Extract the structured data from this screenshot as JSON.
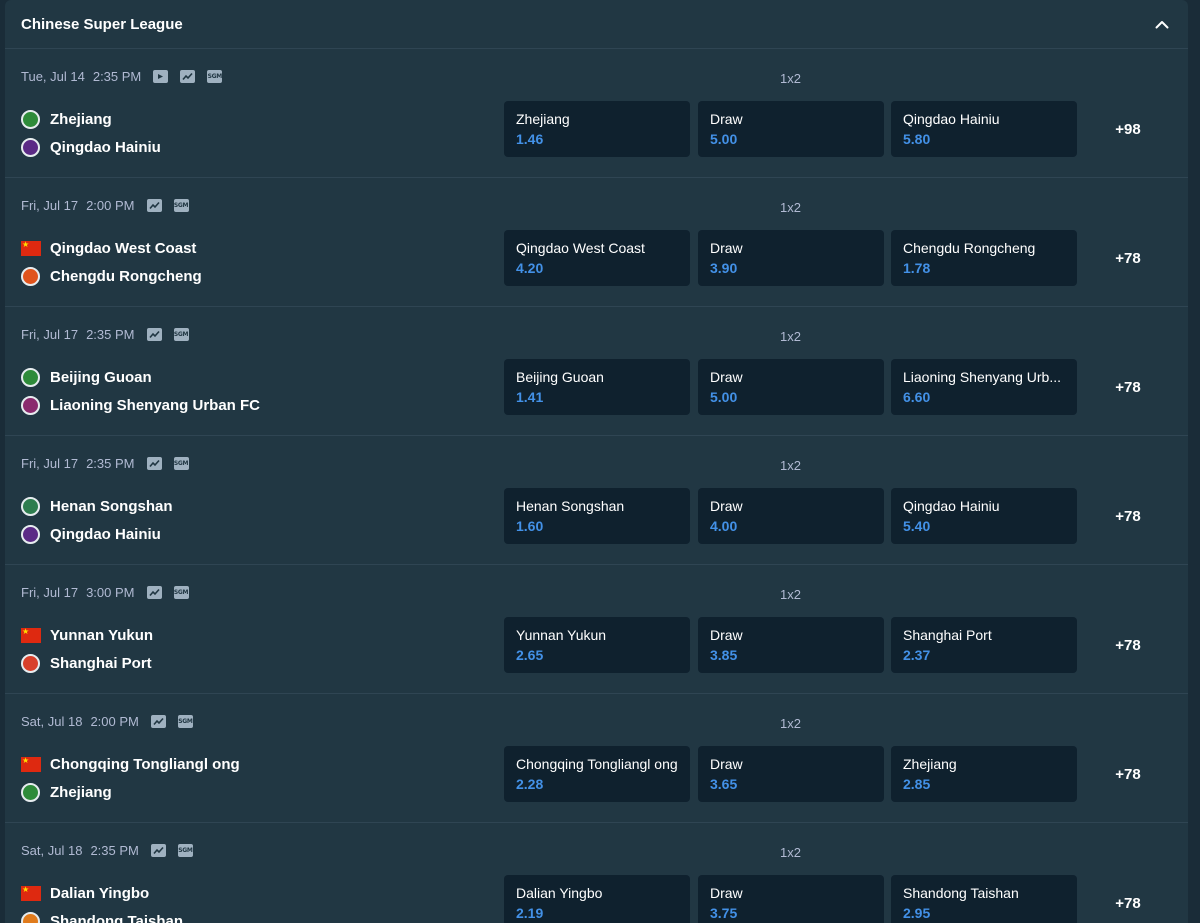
{
  "league": {
    "title": "Chinese Super League"
  },
  "market_label": "1x2",
  "matches": [
    {
      "date": "Tue, Jul 14",
      "time": "2:35 PM",
      "home": "Zhejiang",
      "away": "Qingdao Hainiu",
      "odds": [
        {
          "name": "Zhejiang",
          "price": "1.46"
        },
        {
          "name": "Draw",
          "price": "5.00"
        },
        {
          "name": "Qingdao Hainiu",
          "price": "5.80"
        }
      ],
      "more": "+98"
    },
    {
      "date": "Fri, Jul 17",
      "time": "2:00 PM",
      "home": "Qingdao West Coast",
      "away": "Chengdu Rongcheng",
      "odds": [
        {
          "name": "Qingdao West Coast",
          "price": "4.20"
        },
        {
          "name": "Draw",
          "price": "3.90"
        },
        {
          "name": "Chengdu Rongcheng",
          "price": "1.78"
        }
      ],
      "more": "+78"
    },
    {
      "date": "Fri, Jul 17",
      "time": "2:35 PM",
      "home": "Beijing Guoan",
      "away": "Liaoning Shenyang Urban FC",
      "odds": [
        {
          "name": "Beijing Guoan",
          "price": "1.41"
        },
        {
          "name": "Draw",
          "price": "5.00"
        },
        {
          "name": "Liaoning Shenyang Urb...",
          "price": "6.60"
        }
      ],
      "more": "+78"
    },
    {
      "date": "Fri, Jul 17",
      "time": "2:35 PM",
      "home": "Henan Songshan",
      "away": "Qingdao Hainiu",
      "odds": [
        {
          "name": "Henan Songshan",
          "price": "1.60"
        },
        {
          "name": "Draw",
          "price": "4.00"
        },
        {
          "name": "Qingdao Hainiu",
          "price": "5.40"
        }
      ],
      "more": "+78"
    },
    {
      "date": "Fri, Jul 17",
      "time": "3:00 PM",
      "home": "Yunnan Yukun",
      "away": "Shanghai Port",
      "odds": [
        {
          "name": "Yunnan Yukun",
          "price": "2.65"
        },
        {
          "name": "Draw",
          "price": "3.85"
        },
        {
          "name": "Shanghai Port",
          "price": "2.37"
        }
      ],
      "more": "+78"
    },
    {
      "date": "Sat, Jul 18",
      "time": "2:00 PM",
      "home": "Chongqing Tongliangl ong",
      "away": "Zhejiang",
      "odds": [
        {
          "name": "Chongqing Tongliangl ong",
          "price": "2.28"
        },
        {
          "name": "Draw",
          "price": "3.65"
        },
        {
          "name": "Zhejiang",
          "price": "2.85"
        }
      ],
      "more": "+78"
    },
    {
      "date": "Sat, Jul 18",
      "time": "2:35 PM",
      "home": "Dalian Yingbo",
      "away": "Shandong Taishan",
      "odds": [
        {
          "name": "Dalian Yingbo",
          "price": "2.19"
        },
        {
          "name": "Draw",
          "price": "3.75"
        },
        {
          "name": "Shandong Taishan",
          "price": "2.95"
        }
      ],
      "more": "+78"
    }
  ],
  "icons": {
    "sgm": "SGM"
  },
  "colors": {
    "accent_price": "#4391e7",
    "panel": "#213743",
    "button": "#0f212e"
  }
}
